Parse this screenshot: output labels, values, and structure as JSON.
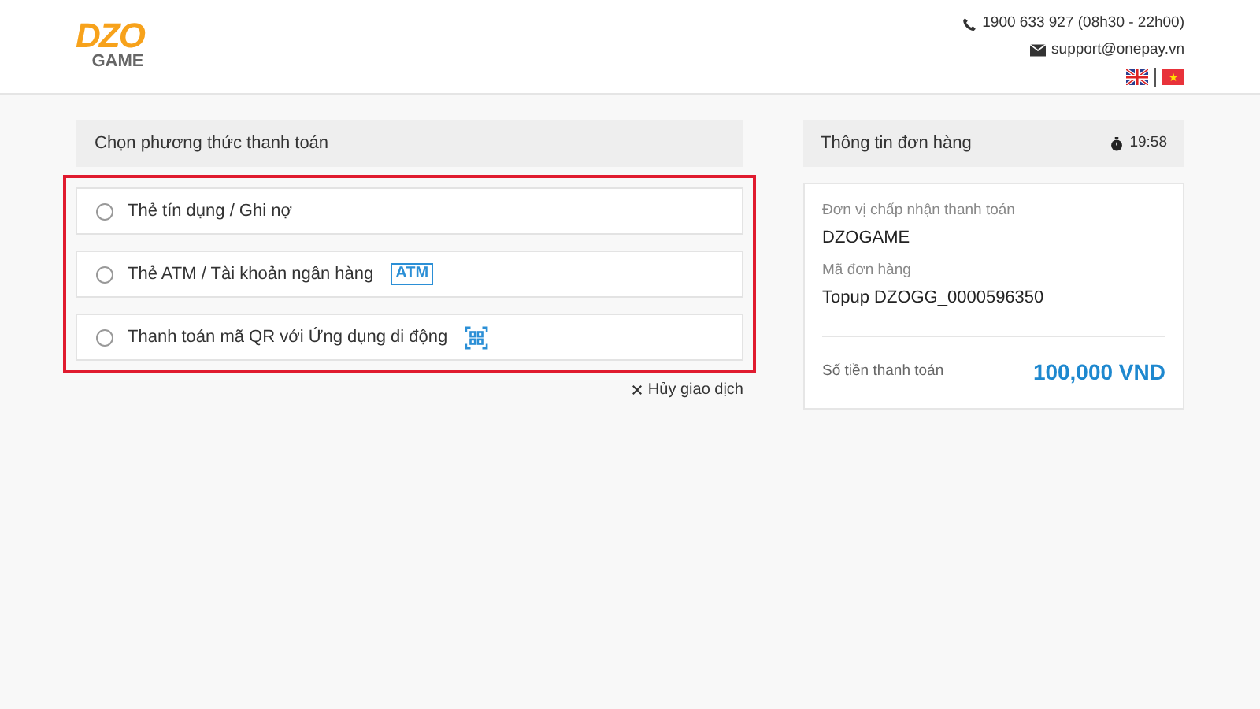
{
  "header": {
    "logo": {
      "top": "DZO",
      "bottom": "GAME"
    },
    "phone": "1900 633 927 (08h30 - 22h00)",
    "email": "support@onepay.vn",
    "languages": [
      {
        "kind": "english"
      },
      {
        "kind": "vietnamese"
      }
    ]
  },
  "payment": {
    "title": "Chọn phương thức thanh toán",
    "methods": [
      {
        "label": "Thẻ tín dụng / Ghi nợ",
        "kind": "plain",
        "selected": false
      },
      {
        "label": "Thẻ ATM / Tài khoản ngân hàng",
        "kind": "badge",
        "badge": "ATM",
        "selected": false
      },
      {
        "label": "Thanh toán mã QR với Ứng dụng di động",
        "kind": "qr",
        "selected": false
      }
    ],
    "cancel": "Hủy giao dịch"
  },
  "order": {
    "title": "Thông tin đơn hàng",
    "timer": "19:58",
    "fields": [
      {
        "label": "Đơn vị chấp nhận thanh toán",
        "value": "DZOGAME"
      },
      {
        "label": "Mã đơn hàng",
        "value": "Topup DZOGG_0000596350"
      }
    ],
    "total_label": "Số tiền thanh toán",
    "total": "100,000 VND"
  }
}
